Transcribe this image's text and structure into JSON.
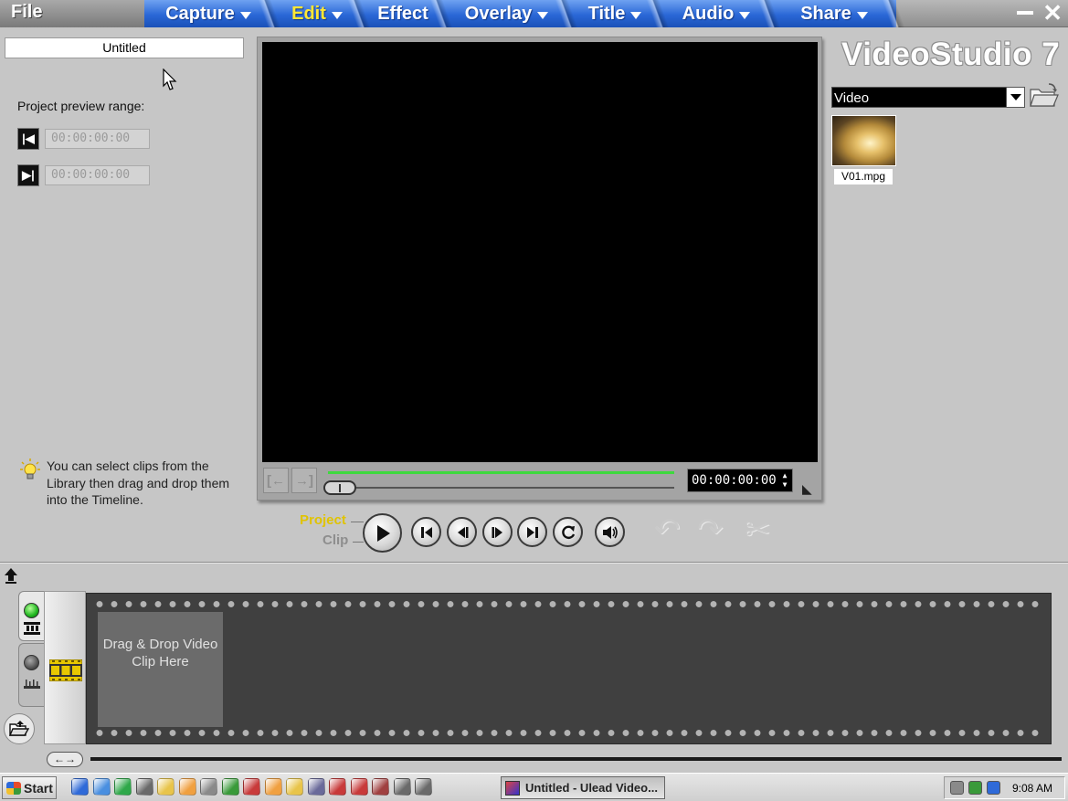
{
  "app": {
    "name": "VideoStudio 7",
    "accent_color": "#2a67d6",
    "active_tab_color": "#ffe733"
  },
  "menu": {
    "file": "File",
    "steps": [
      {
        "label": "Capture",
        "has_dropdown": true,
        "active": false
      },
      {
        "label": "Edit",
        "has_dropdown": true,
        "active": true
      },
      {
        "label": "Effect",
        "has_dropdown": false,
        "active": false
      },
      {
        "label": "Overlay",
        "has_dropdown": true,
        "active": false
      },
      {
        "label": "Title",
        "has_dropdown": true,
        "active": false
      },
      {
        "label": "Audio",
        "has_dropdown": true,
        "active": false
      },
      {
        "label": "Share",
        "has_dropdown": true,
        "active": false
      }
    ]
  },
  "options_panel": {
    "project_name": "Untitled",
    "preview_range_label": "Project preview range:",
    "mark_in_icon": "mark-in-icon",
    "mark_out_icon": "mark-out-icon",
    "range_start": "00:00:00:00",
    "range_end": "00:00:00:00",
    "tip": "You can select clips from the Library then drag and drop them into the Timeline."
  },
  "preview": {
    "timecode": "00:00:00:00",
    "mark_in_icon": "mark-in-icon",
    "mark_out_icon": "mark-out-icon",
    "progress": 0
  },
  "playback": {
    "project_label": "Project",
    "clip_label": "Clip",
    "mode_selected": "Project",
    "buttons": [
      "play-icon",
      "home-icon",
      "previous-frame-icon",
      "next-frame-icon",
      "end-icon",
      "repeat-icon",
      "volume-icon"
    ],
    "disabled_buttons": [
      "undo-icon",
      "redo-icon",
      "split-clip-icon"
    ]
  },
  "library": {
    "brand": "VideoStudio 7",
    "category": "Video",
    "clips": [
      {
        "name": "V01.mpg"
      }
    ]
  },
  "timeline": {
    "drop_hint": "Drag & Drop Video Clip Here",
    "active_view": "storyboard",
    "zoom_icon": "zoom-arrows-icon"
  },
  "taskbar": {
    "start": "Start",
    "task": "Untitled - Ulead Video...",
    "clock": "9:08 AM",
    "quicklaunch_colors": [
      "#2f6ad8",
      "#4a8fe0",
      "#2fa84a",
      "#6a6a6a",
      "#e8c44a",
      "#f0a040",
      "#8a8a8a",
      "#3a9a3a",
      "#c83a3a",
      "#f0a040",
      "#e8c44a",
      "#6a6a9a",
      "#c83a3a",
      "#c83a3a",
      "#a04040",
      "#6a6a6a",
      "#6a6a6a"
    ],
    "tray_colors": [
      "#8a8a8a",
      "#3a9a3a",
      "#2f6ad8"
    ]
  }
}
